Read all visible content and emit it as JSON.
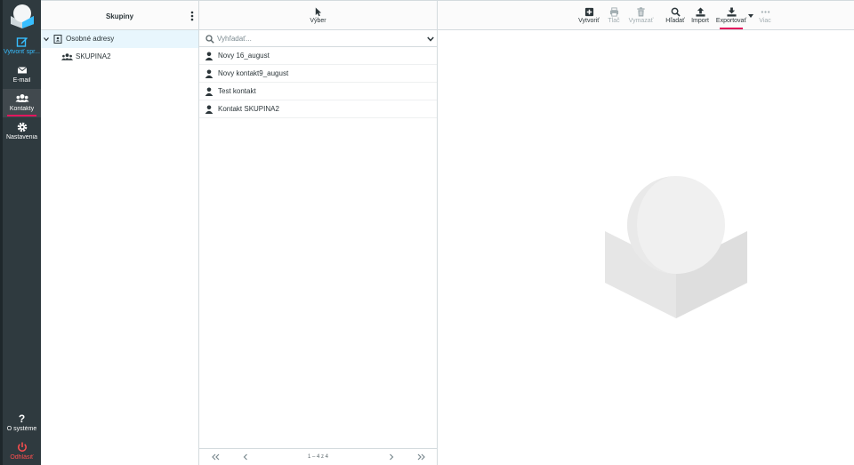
{
  "nav": {
    "compose": "Vytvoriť spr...",
    "mail": "E-mail",
    "contacts": "Kontakty",
    "settings": "Nastavenia",
    "about": "O systéme",
    "logout": "Odhlásiť"
  },
  "groups": {
    "title": "Skupiny",
    "items": [
      {
        "label": "Osobné adresy",
        "icon": "address-book-icon"
      },
      {
        "label": "SKUPINA2",
        "icon": "group-icon"
      }
    ]
  },
  "list": {
    "select_label": "Výber",
    "search_placeholder": "Vyhľadať...",
    "contacts": [
      {
        "name": "Novy 16_august"
      },
      {
        "name": "Novy kontakt9_august"
      },
      {
        "name": "Test kontakt"
      },
      {
        "name": "Kontakt SKUPINA2"
      }
    ],
    "pager_info": "1 – 4 z 4"
  },
  "toolbar": {
    "create": "Vytvoriť",
    "print": "Tlač",
    "delete": "Vymazať",
    "search": "Hľadať",
    "import": "Import",
    "export": "Exportovať",
    "more": "Viac"
  },
  "colors": {
    "accent": "#37beff",
    "active_underline": "#e3165d",
    "nav_bg": "#2f3a3f",
    "logout": "#ff4e4e"
  }
}
